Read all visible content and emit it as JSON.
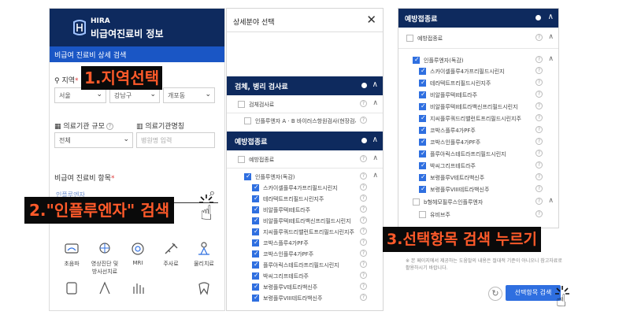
{
  "app": {
    "logo_small": "HIRA",
    "logo_main": "비급여진료비 정보",
    "subbar_title": "비급여 진료비 상세 검색",
    "region_label": "지역",
    "region_selects": [
      "서울",
      "강남구",
      "개포동"
    ],
    "scale_label": "의료기관 규모",
    "scale_value": "전체",
    "name_label": "의료기관명칭",
    "name_placeholder": "병원명 입력",
    "item_label": "비급여 진료비 항목",
    "search_value": "인플루엔자",
    "icon_cells": [
      {
        "icon": "ultrasound-icon",
        "label": "초음파"
      },
      {
        "icon": "imaging-icon",
        "label": "영상진단 및 방사선치료"
      },
      {
        "icon": "mri-icon",
        "label": "MRI"
      },
      {
        "icon": "injection-icon",
        "label": "주사료"
      },
      {
        "icon": "therapy-icon",
        "label": "물리치료"
      }
    ]
  },
  "modal": {
    "title": "상세분야 선택",
    "section1": "검체, 병리 검사료",
    "section1_sub": "검체검사료",
    "section1_item": "인플루엔자 A · B 바이러스항원검사(현장검사)",
    "section2": "예방접종료",
    "section2_sub": "예방접종료",
    "group": "인플루엔자(독감)",
    "items": [
      "스카이셀플루4가프리필드시린지",
      "테라텍트프리필드시린지주",
      "비알플루텍I테트라주",
      "비알플루텍I테트라백신프리필드시린지",
      "지씨플루쿼드리밸런트프리필드시린지주",
      "코박스플루4가PF주",
      "코박스인플루4가PF주",
      "플루아릭스테트라프리필드시린지",
      "박씨그리프테트라주",
      "보령플루V테트라백신주",
      "보령플루VIII테트라백신주"
    ]
  },
  "modal3": {
    "title": "예방접종료",
    "sub": "예방접종료",
    "group": "인플루엔자(독감)",
    "items": [
      "스카이셀플루4가프리필드시린지",
      "테라텍트프리필드시린지주",
      "비알플루텍I테트라주",
      "비알플루텍I테트라백신프리필드시린지",
      "지씨플루쿼드리밸런트프리필드시린지주",
      "코박스플루4가PF주",
      "코박스인플루4가PF주",
      "플루아릭스테트라프리필드시린지",
      "박씨그리프테트라주",
      "보령플루V테트라백신주",
      "보령플루VIII테트라백신주"
    ],
    "group2": "b형헤모필루스인플루엔자",
    "group2_item": "유비브주",
    "notice": "※ 본 페이지에서 제공하는 도움말의 내용은 절대적 기준이 아니오니 참고자료로 활용하시기 바랍니다.",
    "button": "선택항목 검색"
  },
  "annotations": {
    "step1": "1.지역선택",
    "step2": "2.\"인플루엔자\" 검색",
    "step3": "3.선택항목 검색 누르기"
  },
  "colors": {
    "navy": "#0e2a5e",
    "blue": "#1a56c5",
    "accent": "#2f6fe0",
    "annotation": "#ff5a2a"
  }
}
